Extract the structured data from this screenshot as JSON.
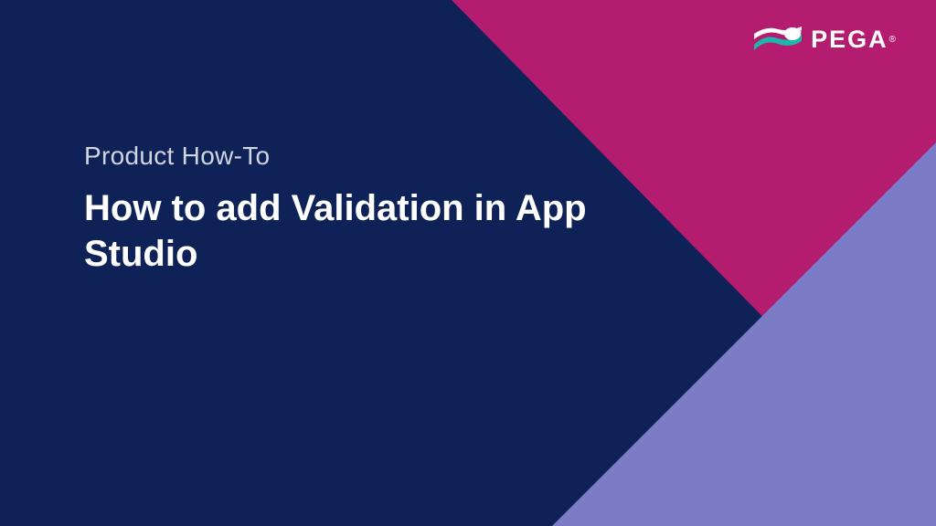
{
  "slide": {
    "subtitle": "Product How-To",
    "title": "How to add Validation in App Studio"
  },
  "brand": {
    "name": "PEGA",
    "trademark": "®"
  },
  "colors": {
    "background": "#0f2258",
    "magenta": "#b31c6f",
    "purple": "#7b7cc5",
    "text": "#ffffff",
    "subtitle_text": "#d0d5e0"
  }
}
